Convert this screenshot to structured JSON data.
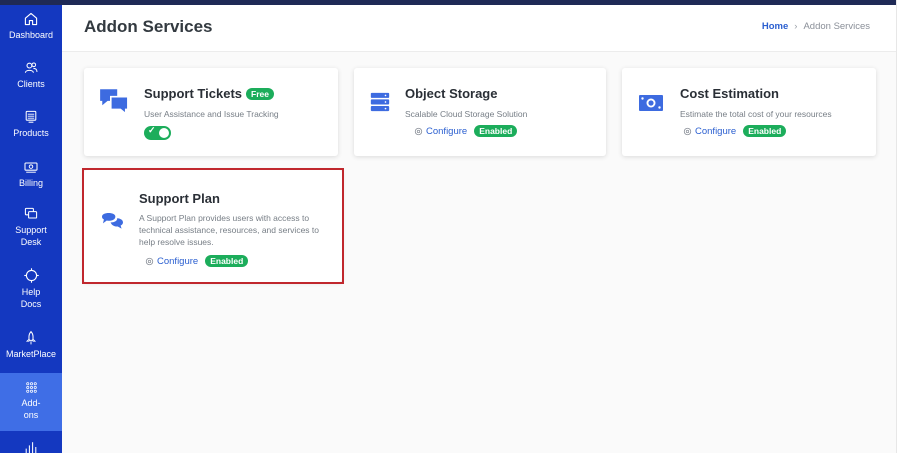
{
  "sidebar": {
    "items": [
      {
        "label": "Dashboard",
        "icon": "home-icon"
      },
      {
        "label": "Clients",
        "icon": "users-icon"
      },
      {
        "label": "Products",
        "icon": "server-icon"
      },
      {
        "label": "Billing",
        "icon": "money-icon"
      },
      {
        "label": "Support\nDesk",
        "icon": "chat-window-icon"
      },
      {
        "label": "Help\nDocs",
        "icon": "lifebuoy-icon"
      },
      {
        "label": "MarketPlace",
        "icon": "rocket-icon"
      },
      {
        "label": "Add-\nons",
        "icon": "grid-dots-icon"
      }
    ],
    "active_index": 7,
    "colors": {
      "background": "#1438c0",
      "active": "#3f6ee6"
    }
  },
  "header": {
    "title": "Addon Services",
    "breadcrumb": {
      "home": "Home",
      "separator": "›",
      "current": "Addon Services"
    }
  },
  "cards": {
    "support_tickets": {
      "title": "Support Tickets",
      "badge": "Free",
      "description": "User Assistance and Issue Tracking",
      "toggle_on": true,
      "icon": "chat-bubbles-icon"
    },
    "object_storage": {
      "title": "Object Storage",
      "description": "Scalable Cloud Storage Solution",
      "configure": "Configure",
      "status": "Enabled",
      "icon": "storage-icon"
    },
    "cost_estimation": {
      "title": "Cost Estimation",
      "description": "Estimate the total cost of your resources",
      "configure": "Configure",
      "status": "Enabled",
      "icon": "money-bill-icon"
    },
    "support_plan": {
      "title": "Support Plan",
      "description": "A Support Plan provides users with access to technical assistance, resources, and services to help resolve issues.",
      "configure": "Configure",
      "status": "Enabled",
      "icon": "comments-icon"
    }
  },
  "colors": {
    "accent": "#2b5fd0",
    "enabled": "#1cad5b",
    "icon_blue": "#3d6be0",
    "highlight": "#c0272d"
  }
}
